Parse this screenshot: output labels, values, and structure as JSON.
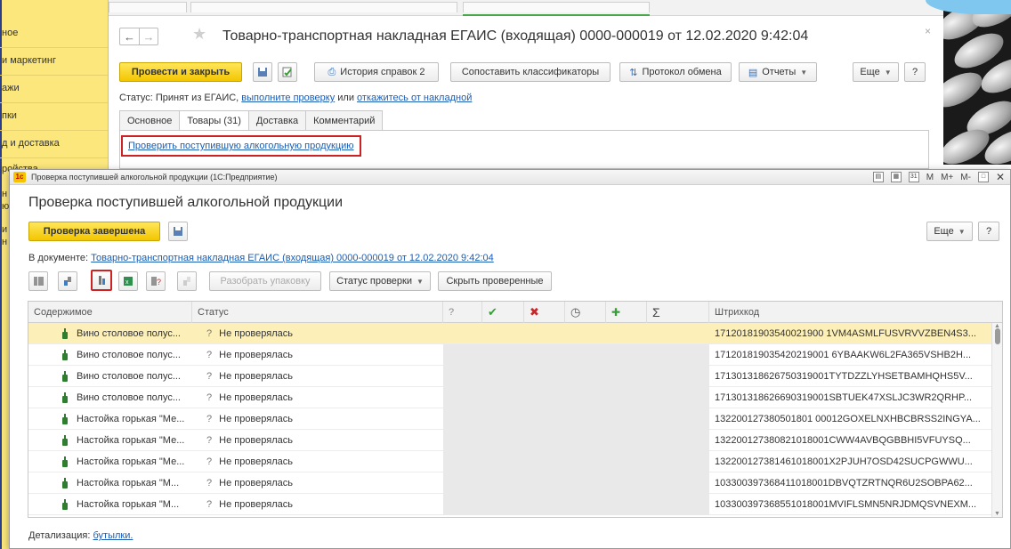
{
  "left_nav": {
    "items": [
      "ное",
      "и маркетинг",
      "ажи",
      "пки",
      "д и доставка",
      "ройства",
      "н",
      "ю",
      "и",
      "н"
    ]
  },
  "document_window": {
    "title": "Товарно-транспортная накладная ЕГАИС (входящая) 0000-000019 от 12.02.2020 9:42:04",
    "back_icon": "←",
    "forward_icon": "→",
    "star_icon": "★",
    "close_icon": "×",
    "toolbar": {
      "post_and_close": "Провести и закрыть",
      "history": "История справок 2",
      "compare": "Сопоставить классификаторы",
      "exchange_log": "Протокол обмена",
      "reports": "Отчеты",
      "more": "Еще",
      "help": "?"
    },
    "status": {
      "prefix": "Статус:  Принят из ЕГАИС,",
      "link1": "выполните проверку",
      "middle": "или",
      "link2": "откажитесь от накладной"
    },
    "tabs": [
      "Основное",
      "Товары (31)",
      "Доставка",
      "Комментарий"
    ],
    "active_tab": 1,
    "check_link": "Проверить поступившую алкогольную продукцию"
  },
  "modal": {
    "window_title": "Проверка поступившей алкогольной продукции  (1С:Предприятие)",
    "logo_text": "1с",
    "title_tools": [
      "M",
      "M+",
      "M-"
    ],
    "heading": "Проверка поступившей алкогольной продукции",
    "complete_button": "Проверка завершена",
    "more_button": "Еще",
    "help_button": "?",
    "doc_prefix": "В документе:",
    "doc_link": "Товарно-транспортная накладная ЕГАИС (входящая) 0000-000019 от 12.02.2020 9:42:04",
    "toolbar": {
      "unpack": "Разобрать упаковку",
      "check_status": "Статус проверки",
      "hide_checked": "Скрыть проверенные"
    },
    "columns": {
      "content": "Содержимое",
      "status": "Статус",
      "q": "?",
      "ok": "✔",
      "x": "✖",
      "clock": "◷",
      "plus": "✚",
      "sigma": "Σ",
      "barcode": "Штрихкод"
    },
    "rows": [
      {
        "content": "Вино столовое полус...",
        "q": "?",
        "status": "Не проверялась",
        "barcode": "17120181903540021900 1VM4ASMLFUSVRVVZBEN4S3..."
      },
      {
        "content": "Вино столовое полус...",
        "q": "?",
        "status": "Не проверялась",
        "barcode": "171201819035420219001 6YBAAKW6L2FA365VSHB2H..."
      },
      {
        "content": "Вино столовое полус...",
        "q": "?",
        "status": "Не проверялась",
        "barcode": "171301318626750319001TYTDZZLYHSETBAMHQHS5V..."
      },
      {
        "content": "Вино столовое полус...",
        "q": "?",
        "status": "Не проверялась",
        "barcode": "171301318626690319001SBTUEK47XSLJC3WR2QRHP..."
      },
      {
        "content": "Настойка горькая \"Ме...",
        "q": "?",
        "status": "Не проверялась",
        "barcode": "132200127380501801 00012GOXELNXHBCBRSS2INGYA..."
      },
      {
        "content": "Настойка горькая \"Ме...",
        "q": "?",
        "status": "Не проверялась",
        "barcode": "132200127380821018001CWW4AVBQGBBHI5VFUYSQ..."
      },
      {
        "content": "Настойка горькая \"Ме...",
        "q": "?",
        "status": "Не проверялась",
        "barcode": "132200127381461018001X2PJUH7OSD42SUCPGWWU..."
      },
      {
        "content": "Настойка горькая \"М...",
        "q": "?",
        "status": "Не проверялась",
        "barcode": "103300397368411018001DBVQTZRTNQR6U2SOBPA62..."
      },
      {
        "content": "Настойка горькая \"М...",
        "q": "?",
        "status": "Не проверялась",
        "barcode": "103300397368551018001MVIFLSMN5NRJDMQSVNEXM..."
      }
    ],
    "detail_prefix": "Детализация:",
    "detail_link": "бутылки."
  }
}
